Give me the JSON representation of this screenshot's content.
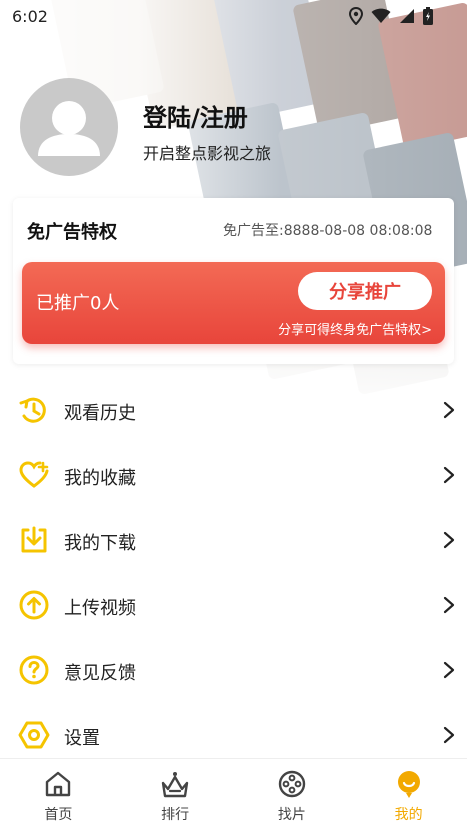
{
  "status_bar": {
    "time": "6:02",
    "icons": [
      "location-icon",
      "wifi-icon",
      "signal-icon",
      "battery-icon"
    ]
  },
  "profile": {
    "title": "登陆/注册",
    "subtitle": "开启整点影视之旅"
  },
  "ad_card": {
    "title": "免广告特权",
    "until_label": "免广告至:",
    "until_value": "8888-08-08 08:08:08",
    "promoted_count_text": "已推广0人",
    "share_button": "分享推广",
    "share_hint": "分享可得终身免广告特权>"
  },
  "menu": {
    "items": [
      {
        "label": "观看历史",
        "icon": "history-icon"
      },
      {
        "label": "我的收藏",
        "icon": "favorite-heart-icon"
      },
      {
        "label": "我的下载",
        "icon": "download-icon"
      },
      {
        "label": "上传视频",
        "icon": "upload-icon"
      },
      {
        "label": "意见反馈",
        "icon": "feedback-question-icon"
      },
      {
        "label": "设置",
        "icon": "settings-hexagon-icon"
      }
    ]
  },
  "bottom_nav": {
    "items": [
      {
        "label": "首页",
        "icon": "home-icon"
      },
      {
        "label": "排行",
        "icon": "ranking-crown-icon"
      },
      {
        "label": "找片",
        "icon": "film-reel-icon"
      },
      {
        "label": "我的",
        "icon": "profile-icon"
      }
    ],
    "active_index": 3
  },
  "colors": {
    "accent_yellow": "#f2a900",
    "promo_red": "#e8453b",
    "icon_yellow": "#f5c400"
  }
}
